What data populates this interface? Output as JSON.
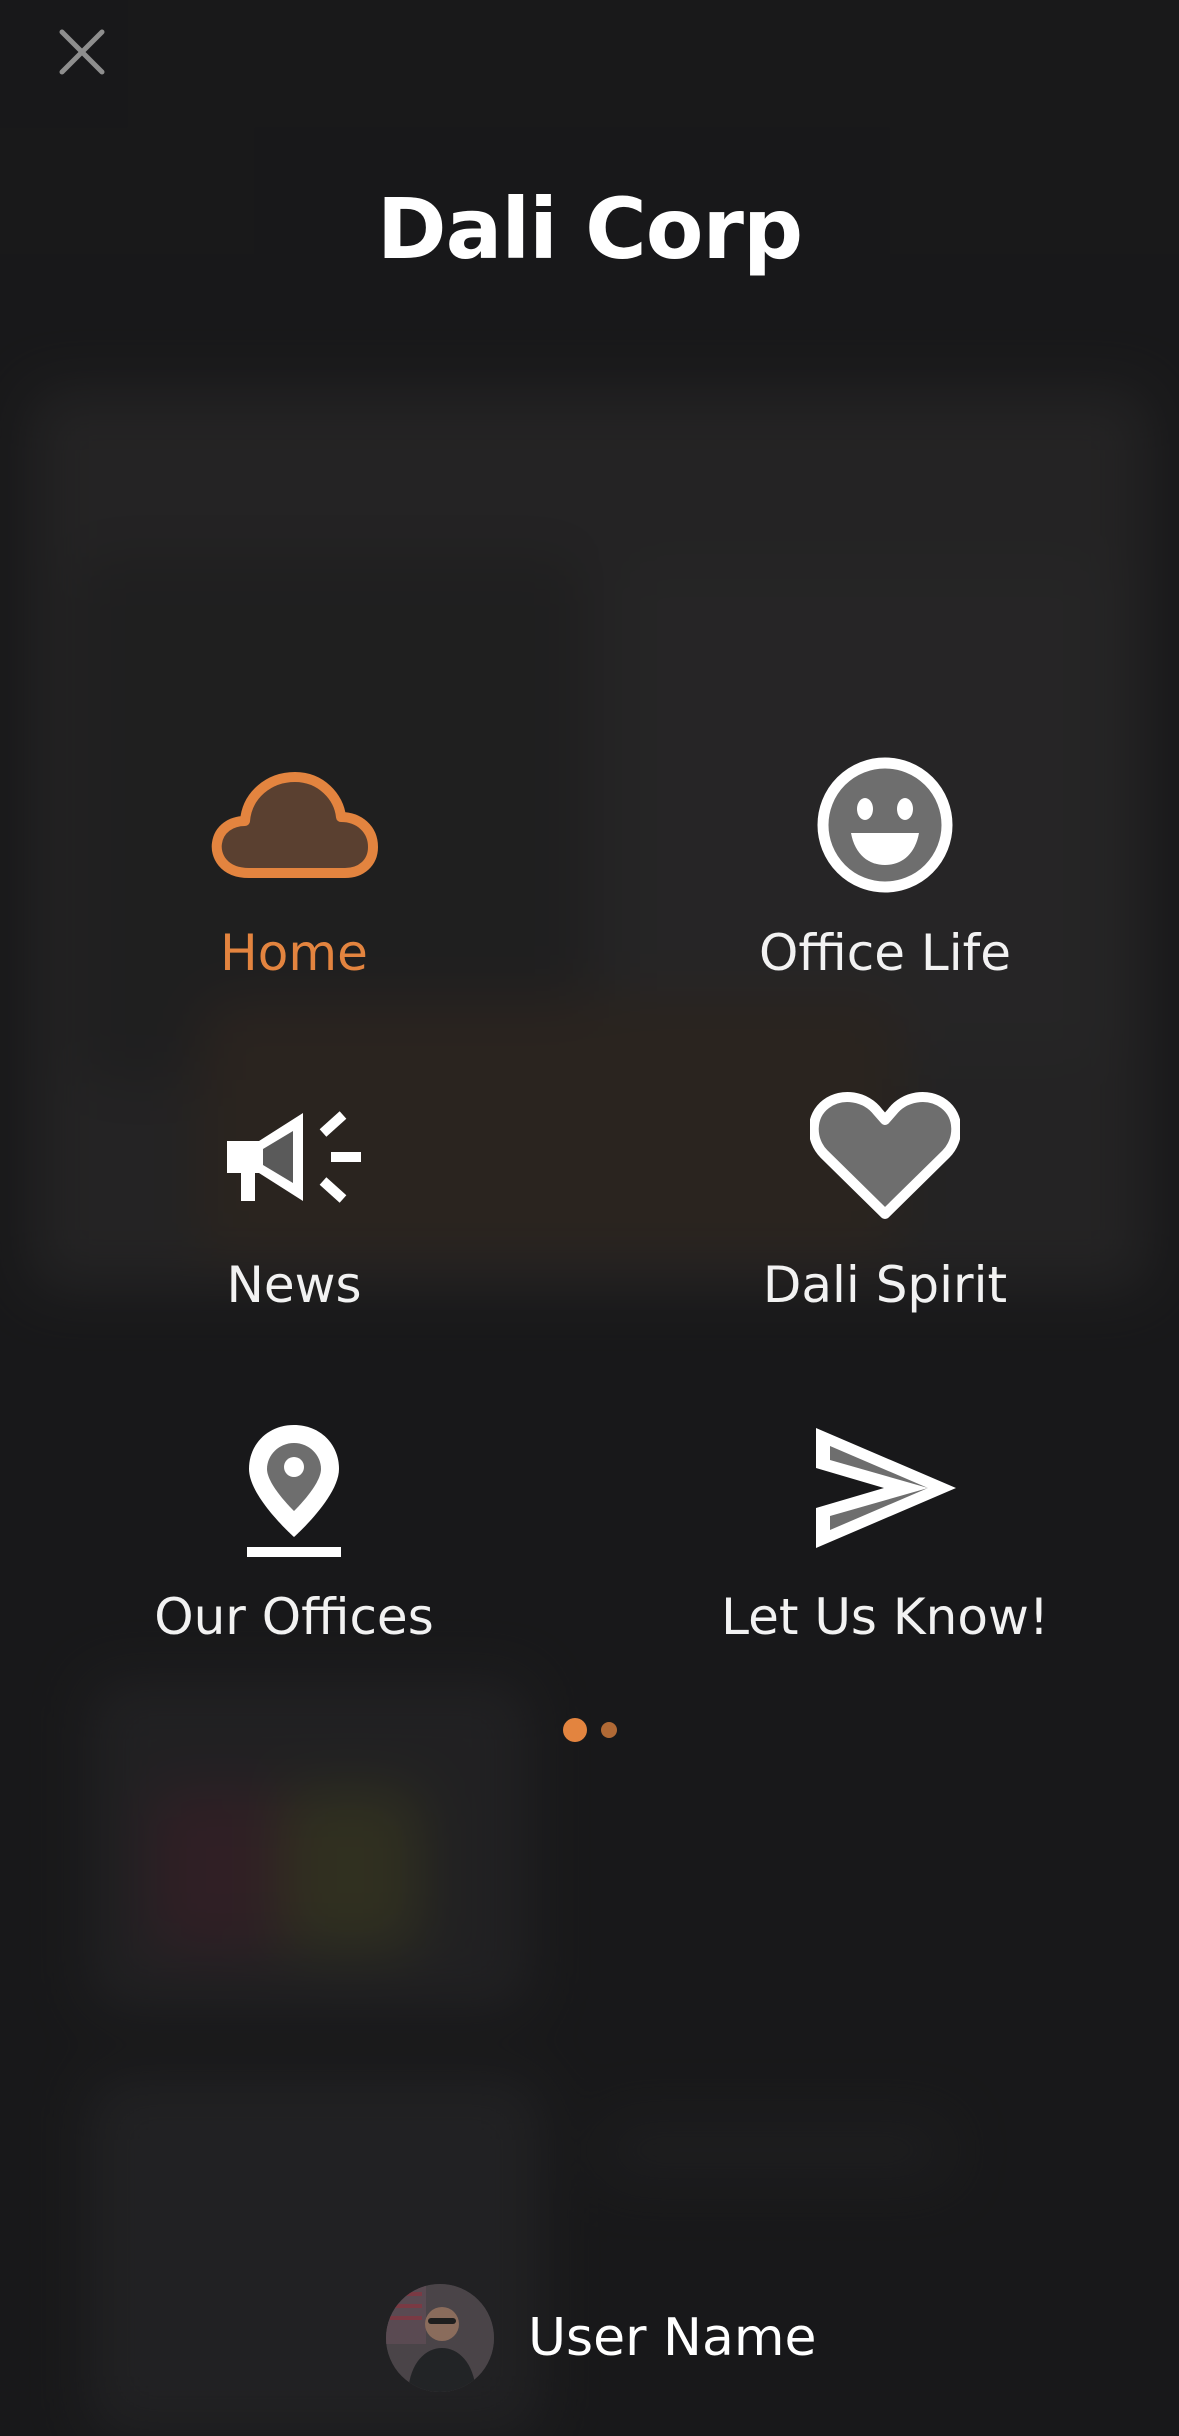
{
  "app": {
    "title": "Dali Corp"
  },
  "close_button": {
    "icon": "close-icon"
  },
  "menu": {
    "items": [
      {
        "label": "Home",
        "icon": "cloud-icon",
        "active": true
      },
      {
        "label": "Office Life",
        "icon": "smiley-icon",
        "active": false
      },
      {
        "label": "News",
        "icon": "megaphone-icon",
        "active": false
      },
      {
        "label": "Dali Spirit",
        "icon": "heart-icon",
        "active": false
      },
      {
        "label": "Our Offices",
        "icon": "location-pin-icon",
        "active": false
      },
      {
        "label": "Let Us Know!",
        "icon": "send-icon",
        "active": false
      }
    ]
  },
  "pager": {
    "current_page": 1,
    "page_count": 2
  },
  "user": {
    "name": "User Name",
    "avatar_icon": "avatar"
  },
  "colors": {
    "accent": "#e3843f",
    "background": "#1c1c1d",
    "text": "#ffffff",
    "icon_fill": "#707070"
  }
}
